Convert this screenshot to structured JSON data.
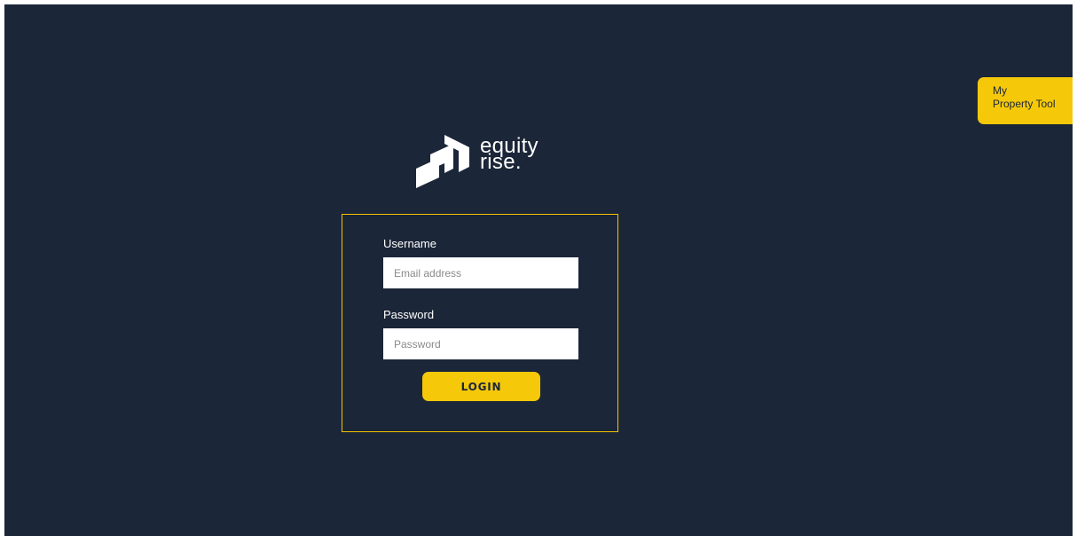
{
  "brand": {
    "line1": "equity",
    "line2": "rise."
  },
  "login": {
    "username_label": "Username",
    "username_placeholder": "Email address",
    "username_value": "",
    "password_label": "Password",
    "password_placeholder": "Password",
    "password_value": "",
    "button_label": "LOGIN"
  },
  "side_tab": {
    "line1": "My",
    "line2": "Property Tool"
  },
  "colors": {
    "background": "#1b2638",
    "accent": "#f5c80a",
    "panel_border": "#f5c400",
    "text": "#ffffff"
  },
  "icons": {
    "logo": "equity-rise-logo-icon"
  }
}
